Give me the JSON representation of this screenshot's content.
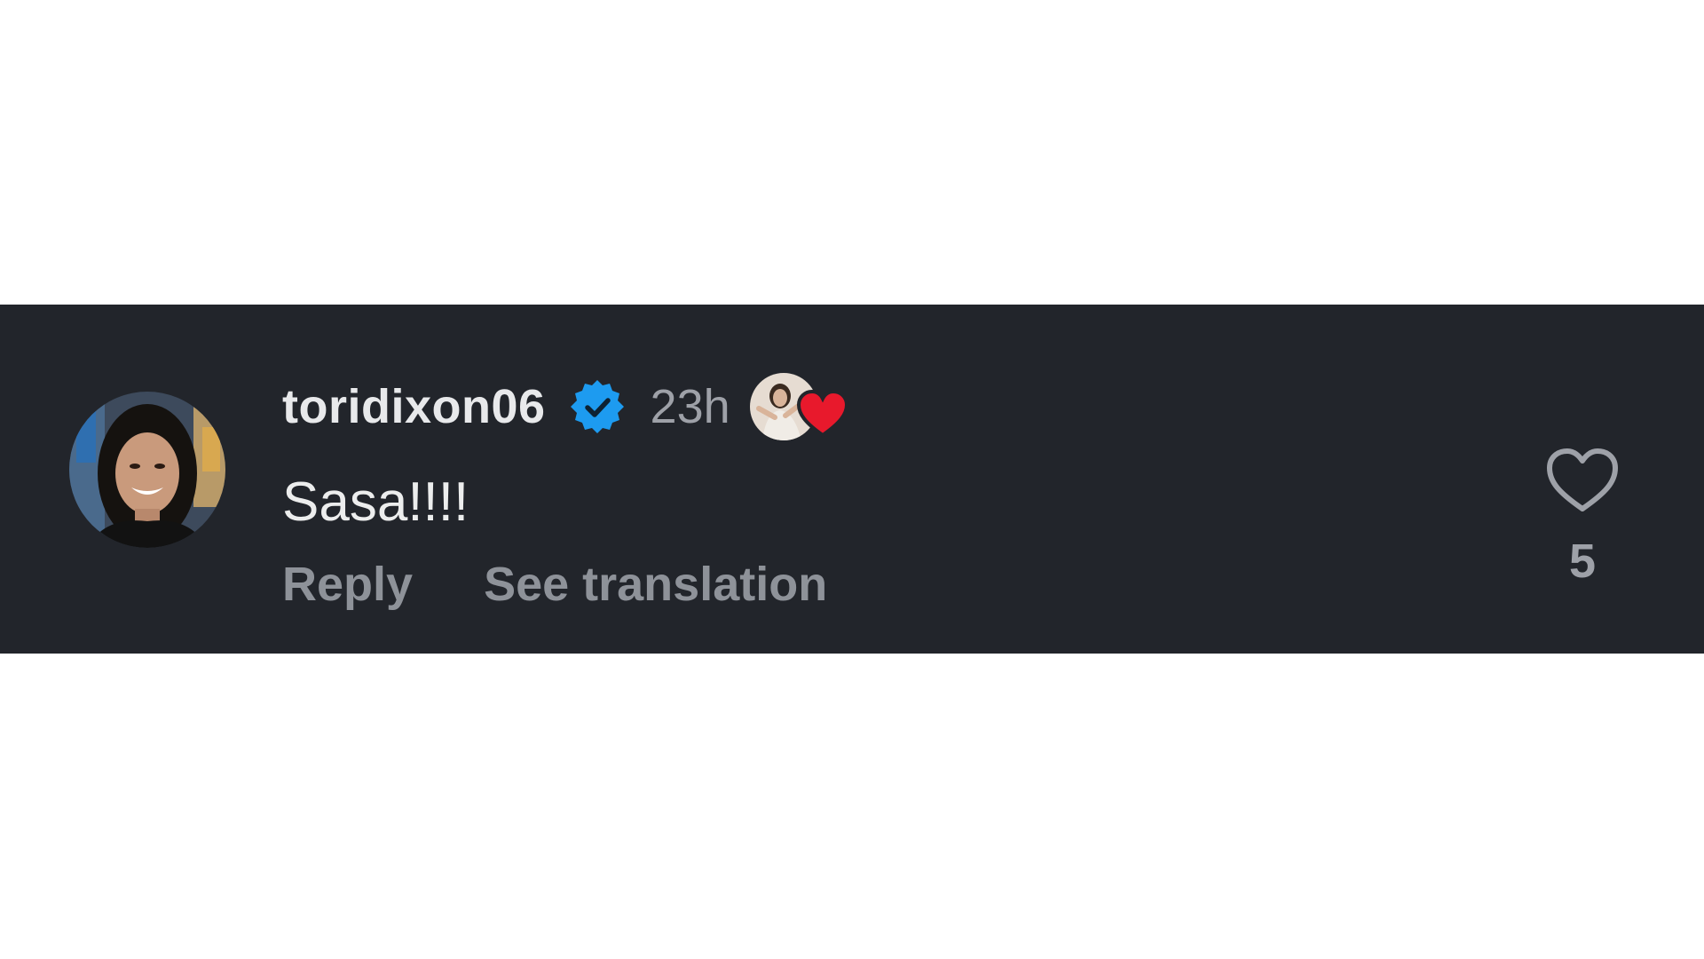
{
  "comment": {
    "username": "toridixon06",
    "verified": true,
    "timestamp": "23h",
    "liked_by_creator": true,
    "text": "Sasa!!!!",
    "actions": {
      "reply": "Reply",
      "see_translation": "See translation"
    },
    "like_count": "5",
    "icons": {
      "verified": "verified-badge-icon",
      "creator_heart": "heart-filled-icon",
      "like": "heart-outline-icon"
    }
  },
  "colors": {
    "background": "#22252b",
    "username": "#e8e9eb",
    "secondary_text": "#9ea1a8",
    "verified_badge": "#1d9bf0",
    "creator_heart": "#e8192c"
  }
}
